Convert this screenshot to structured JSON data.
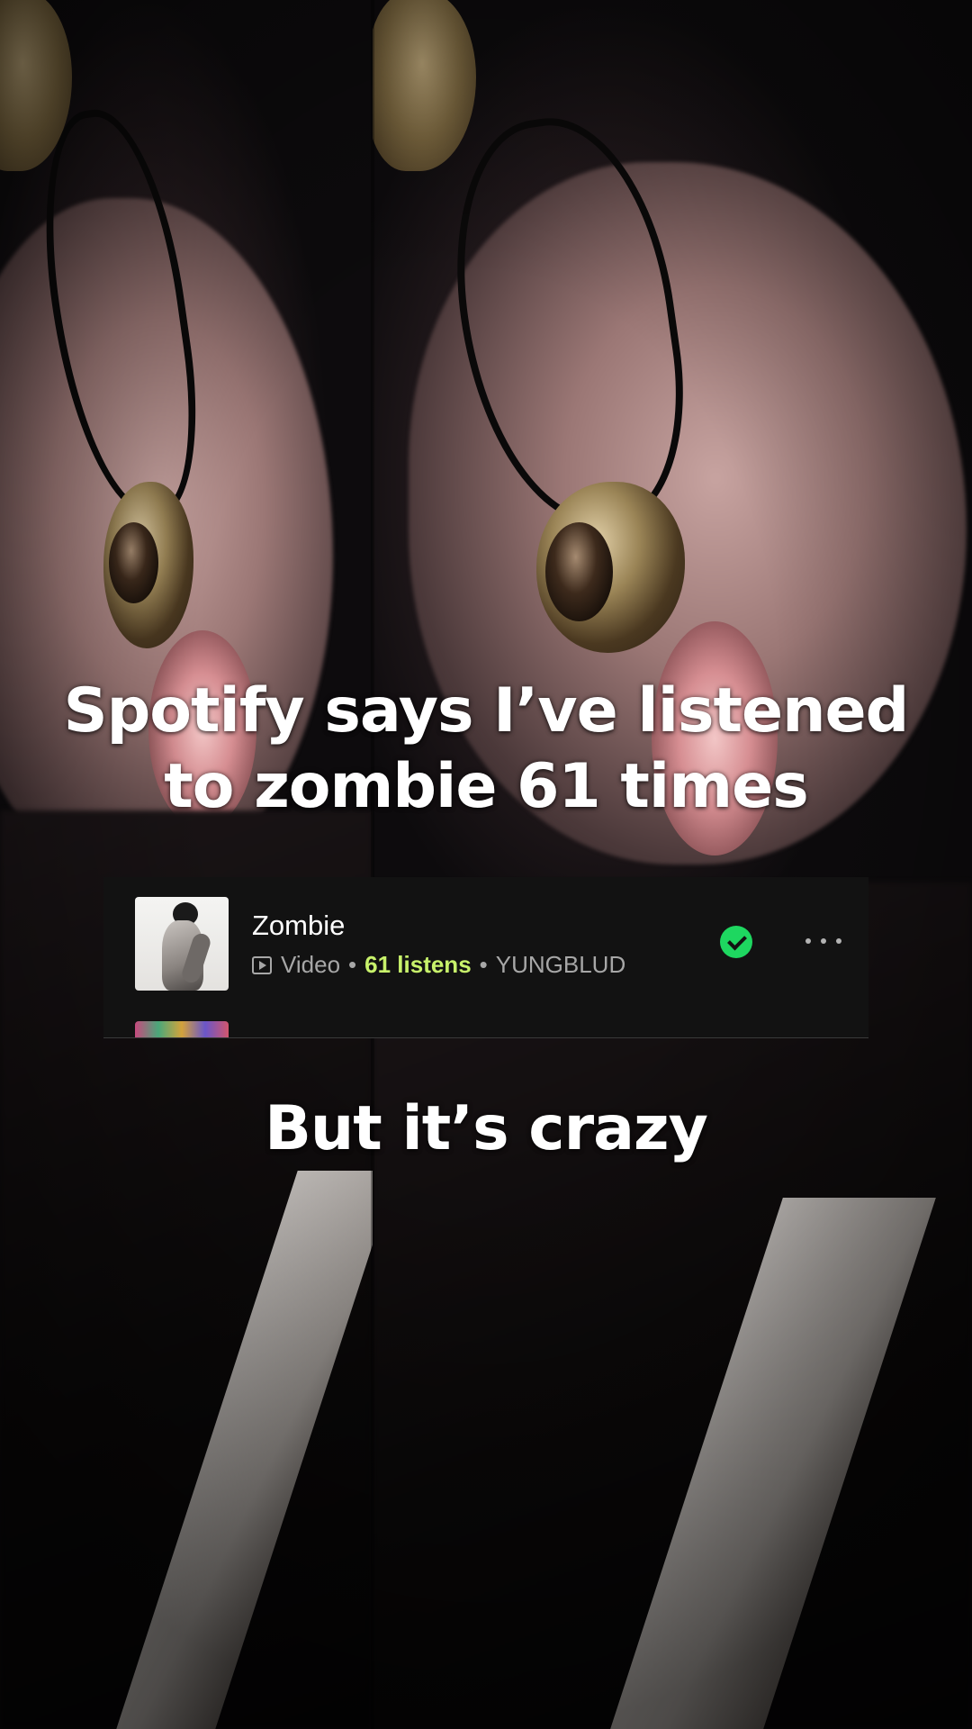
{
  "captions": {
    "top_line1": "Spotify says I’ve listened",
    "top_line2": "to zombie 61 times",
    "bottom": "But it’s crazy"
  },
  "track": {
    "title": "Zombie",
    "type": "Video",
    "listens": "61 listens",
    "separator": "•",
    "artist": "YUNGBLUD",
    "saved_icon": "check-circle-icon",
    "more_icon": "more-horizontal-icon"
  },
  "colors": {
    "card_background": "#121212",
    "listens_highlight": "#c8f26b",
    "saved_green": "#1ed760",
    "caption_text": "#ffffff"
  }
}
